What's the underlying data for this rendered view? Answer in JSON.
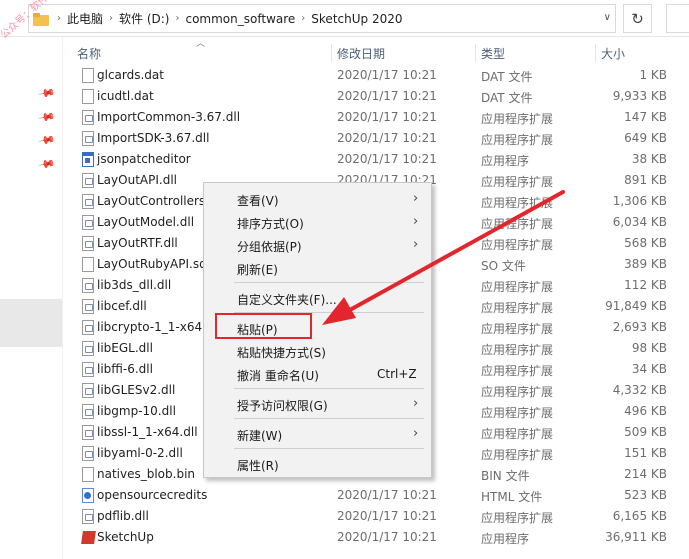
{
  "address": {
    "crumbs": [
      "此电脑",
      "软件 (D:)",
      "common_software",
      "SketchUp 2020"
    ],
    "refresh_glyph": "↻"
  },
  "watermark": "公众号：软件管家",
  "columns": {
    "name": "名称",
    "date": "修改日期",
    "type": "类型",
    "size": "大小"
  },
  "files": [
    {
      "name": "glcards.dat",
      "date": "2020/1/17 10:21",
      "type": "DAT 文件",
      "size": "1 KB",
      "icon": "dat"
    },
    {
      "name": "icudtl.dat",
      "date": "2020/1/17 10:21",
      "type": "DAT 文件",
      "size": "9,933 KB",
      "icon": "dat"
    },
    {
      "name": "ImportCommon-3.67.dll",
      "date": "2020/1/17 10:21",
      "type": "应用程序扩展",
      "size": "147 KB",
      "icon": "dll"
    },
    {
      "name": "ImportSDK-3.67.dll",
      "date": "2020/1/17 10:21",
      "type": "应用程序扩展",
      "size": "649 KB",
      "icon": "dll"
    },
    {
      "name": "jsonpatcheditor",
      "date": "2020/1/17 10:21",
      "type": "应用程序",
      "size": "38 KB",
      "icon": "exe"
    },
    {
      "name": "LayOutAPI.dll",
      "date": "2020/1/17 10:21",
      "type": "应用程序扩展",
      "size": "891 KB",
      "icon": "dll"
    },
    {
      "name": "LayOutControllers",
      "date": "",
      "type": "应用程序扩展",
      "size": "1,306 KB",
      "icon": "dll"
    },
    {
      "name": "LayOutModel.dll",
      "date": "",
      "type": "应用程序扩展",
      "size": "6,034 KB",
      "icon": "dll"
    },
    {
      "name": "LayOutRTF.dll",
      "date": "",
      "type": "应用程序扩展",
      "size": "568 KB",
      "icon": "dll"
    },
    {
      "name": "LayOutRubyAPI.so",
      "date": "",
      "type": "SO 文件",
      "size": "389 KB",
      "icon": "dat"
    },
    {
      "name": "lib3ds_dll.dll",
      "date": "",
      "type": "应用程序扩展",
      "size": "112 KB",
      "icon": "dll"
    },
    {
      "name": "libcef.dll",
      "date": "",
      "type": "应用程序扩展",
      "size": "91,849 KB",
      "icon": "dll"
    },
    {
      "name": "libcrypto-1_1-x64.d",
      "date": "",
      "type": "应用程序扩展",
      "size": "2,693 KB",
      "icon": "dll"
    },
    {
      "name": "libEGL.dll",
      "date": "",
      "type": "应用程序扩展",
      "size": "98 KB",
      "icon": "dll"
    },
    {
      "name": "libffi-6.dll",
      "date": "",
      "type": "应用程序扩展",
      "size": "34 KB",
      "icon": "dll"
    },
    {
      "name": "libGLESv2.dll",
      "date": "",
      "type": "应用程序扩展",
      "size": "4,332 KB",
      "icon": "dll"
    },
    {
      "name": "libgmp-10.dll",
      "date": "",
      "type": "应用程序扩展",
      "size": "496 KB",
      "icon": "dll"
    },
    {
      "name": "libssl-1_1-x64.dll",
      "date": "",
      "type": "应用程序扩展",
      "size": "509 KB",
      "icon": "dll"
    },
    {
      "name": "libyaml-0-2.dll",
      "date": "",
      "type": "应用程序扩展",
      "size": "151 KB",
      "icon": "dll"
    },
    {
      "name": "natives_blob.bin",
      "date": "",
      "type": "BIN 文件",
      "size": "214 KB",
      "icon": "dat"
    },
    {
      "name": "opensourcecredits",
      "date": "2020/1/17 10:21",
      "type": "HTML 文件",
      "size": "523 KB",
      "icon": "html"
    },
    {
      "name": "pdflib.dll",
      "date": "2020/1/17 10:21",
      "type": "应用程序扩展",
      "size": "6,165 KB",
      "icon": "dll"
    },
    {
      "name": "SketchUp",
      "date": "2020/1/17 10:21",
      "type": "应用程序",
      "size": "36,911 KB",
      "icon": "sketchup"
    }
  ],
  "context_menu": {
    "items": [
      {
        "label": "查看(V)",
        "submenu": true,
        "shortcut": ""
      },
      {
        "label": "排序方式(O)",
        "submenu": true,
        "shortcut": ""
      },
      {
        "label": "分组依据(P)",
        "submenu": true,
        "shortcut": ""
      },
      {
        "label": "刷新(E)",
        "submenu": false,
        "shortcut": ""
      },
      {
        "label": "自定义文件夹(F)...",
        "submenu": false,
        "shortcut": ""
      },
      {
        "label": "粘贴(P)",
        "submenu": false,
        "shortcut": ""
      },
      {
        "label": "粘贴快捷方式(S)",
        "submenu": false,
        "shortcut": ""
      },
      {
        "label": "撤消 重命名(U)",
        "submenu": false,
        "shortcut": "Ctrl+Z"
      },
      {
        "label": "授予访问权限(G)",
        "submenu": true,
        "shortcut": ""
      },
      {
        "label": "新建(W)",
        "submenu": true,
        "shortcut": ""
      },
      {
        "label": "属性(R)",
        "submenu": false,
        "shortcut": ""
      }
    ]
  },
  "colors": {
    "highlight_box": "#e3262d",
    "arrow": "#e3262d"
  }
}
